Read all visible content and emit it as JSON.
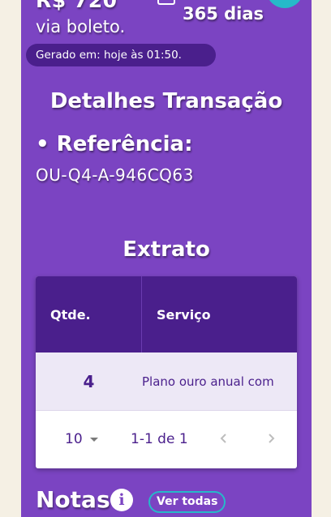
{
  "payment": {
    "amount": "R$ 720",
    "method": "via boleto.",
    "duration": "365 dias",
    "generated": "Gerado em: hoje às 01:50."
  },
  "details": {
    "title": "Detalhes Transação",
    "reference_label": "• Referência:",
    "reference_value": "OU-Q4-A-946CQ63"
  },
  "statement": {
    "title": "Extrato",
    "columns": [
      "Qtde.",
      "Serviço"
    ],
    "rows": [
      {
        "qty": "4",
        "service": "Plano ouro anual com"
      }
    ],
    "pagination": {
      "rows_per_page": "10",
      "range": "1-1 de 1"
    }
  },
  "notes": {
    "title": "Notas",
    "view_all": "Ver todas"
  },
  "icons": {
    "calendar": "calendar-icon",
    "info": "info-icon",
    "prev": "chevron-left-icon",
    "next": "chevron-right-icon",
    "dropdown": "caret-down-icon"
  },
  "colors": {
    "card": "#7b44c2",
    "dark_purple": "#4a1f8c",
    "accent_teal": "#26b9c9",
    "background": "#f5f0e4"
  }
}
